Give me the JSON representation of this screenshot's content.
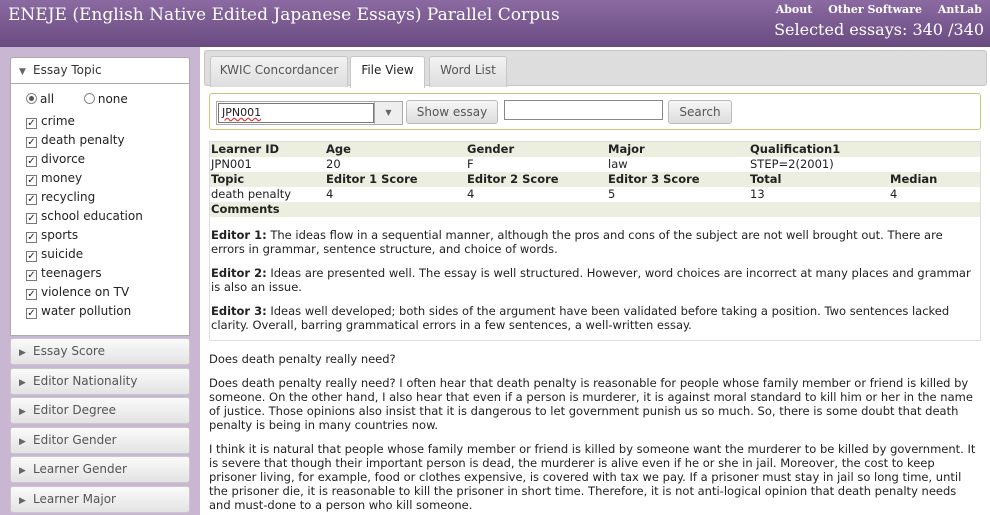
{
  "header": {
    "title": "ENEJE (English Native Edited Japanese Essays) Parallel Corpus",
    "links": [
      "About",
      "Other Software",
      "AntLab"
    ],
    "selected_essays": "Selected essays: 340 /340"
  },
  "sidebar": {
    "essay_topic_label": "Essay Topic",
    "radio_all": "all",
    "radio_none": "none",
    "topics": [
      "crime",
      "death penalty",
      "divorce",
      "money",
      "recycling",
      "school education",
      "sports",
      "suicide",
      "teenagers",
      "violence on TV",
      "water pollution"
    ],
    "panels": [
      "Essay Score",
      "Editor Nationality",
      "Editor Degree",
      "Editor Gender",
      "Learner Gender",
      "Learner Major"
    ]
  },
  "tabs": [
    "KWIC Concordancer",
    "File View",
    "Word List"
  ],
  "toolbar": {
    "file_value": "JPN001",
    "show_essay": "Show essay",
    "search_value": "",
    "search_button": "Search"
  },
  "info": {
    "headers1": [
      "Learner ID",
      "Age",
      "Gender",
      "Major",
      "Qualification1"
    ],
    "values1": [
      "JPN001",
      "20",
      "F",
      "law",
      "STEP=2(2001)"
    ],
    "headers2": [
      "Topic",
      "Editor 1 Score",
      "Editor 2 Score",
      "Editor 3 Score",
      "Total",
      "Median"
    ],
    "values2": [
      "death penalty",
      "4",
      "4",
      "5",
      "13",
      "4"
    ],
    "comments_label": "Comments",
    "comments": [
      {
        "editor": "Editor 1:",
        "text": "The ideas flow in a sequential manner, although the pros and cons of the subject are not well brought out. There are errors in grammar, sentence structure, and choice of words."
      },
      {
        "editor": "Editor 2:",
        "text": "Ideas are presented well. The essay is well structured. However, word choices are incorrect at many places and grammar is also an issue."
      },
      {
        "editor": "Editor 3:",
        "text": "Ideas well developed; both sides of the argument have been validated before taking a position. Two sentences lacked clarity. Overall, barring grammatical errors in a few sentences, a well-written essay."
      }
    ]
  },
  "essay": {
    "title": "Does death penalty really need?",
    "paragraphs": [
      "Does death penalty really need? I often hear that death penalty is reasonable for people whose family member or friend is killed by someone. On the other hand, I also hear that even if a person is murderer, it is against moral standard to kill him or her in the name of justice. Those opinions also insist that it is dangerous to let government punish us so much. So, there is some doubt that death penalty is being in many countries now.",
      "I think it is natural that people whose family member or friend is killed by someone want the murderer to be killed by government. It is severe that though their important person is dead, the murderer is alive even if he or she in jail. Moreover, the cost to keep prisoner living, for example, food or clothes expensive, is covered with tax we pay. If a prisoner must stay in jail so long time, until the prisoner die, it is reasonable to kill the prisoner in short time. Therefore, it is not anti-logical opinion that death penalty needs and must-done to a person who kill someone."
    ]
  }
}
